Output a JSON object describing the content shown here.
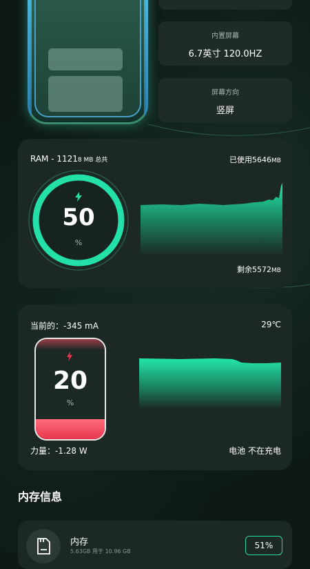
{
  "device": {
    "screen_label": "内置屏幕",
    "screen_value": "6.7英寸 120.0HZ",
    "orientation_label": "屏幕方向",
    "orientation_value": "竖屏"
  },
  "ram": {
    "title_prefix": "RAM - 1121",
    "title_unit": "8 MB 总共",
    "used_prefix": "已使用5646",
    "used_unit": "MB",
    "gauge_value": "50",
    "gauge_unit": "%",
    "remaining_prefix": "剩余5572",
    "remaining_unit": "MB",
    "percent": 50
  },
  "battery": {
    "current": "当前的：-345 mA",
    "temperature": "29℃",
    "level_value": "20",
    "level_unit": "%",
    "level_fraction": 0.2,
    "power": "力量：-1.28 W",
    "status": "电池 不在充电"
  },
  "storage": {
    "section_title": "内存信息",
    "name": "内存",
    "detail": "5.63GB 用于 10.96 GB",
    "badge": "51%"
  },
  "colors": {
    "accent": "#1fe2a8",
    "battery_red": "#e8364e",
    "card_bg": "#1c2824",
    "page_bg": "#0d1714"
  },
  "icons": {
    "bolt": "lightning-bolt-icon",
    "storage": "sd-card-icon"
  }
}
